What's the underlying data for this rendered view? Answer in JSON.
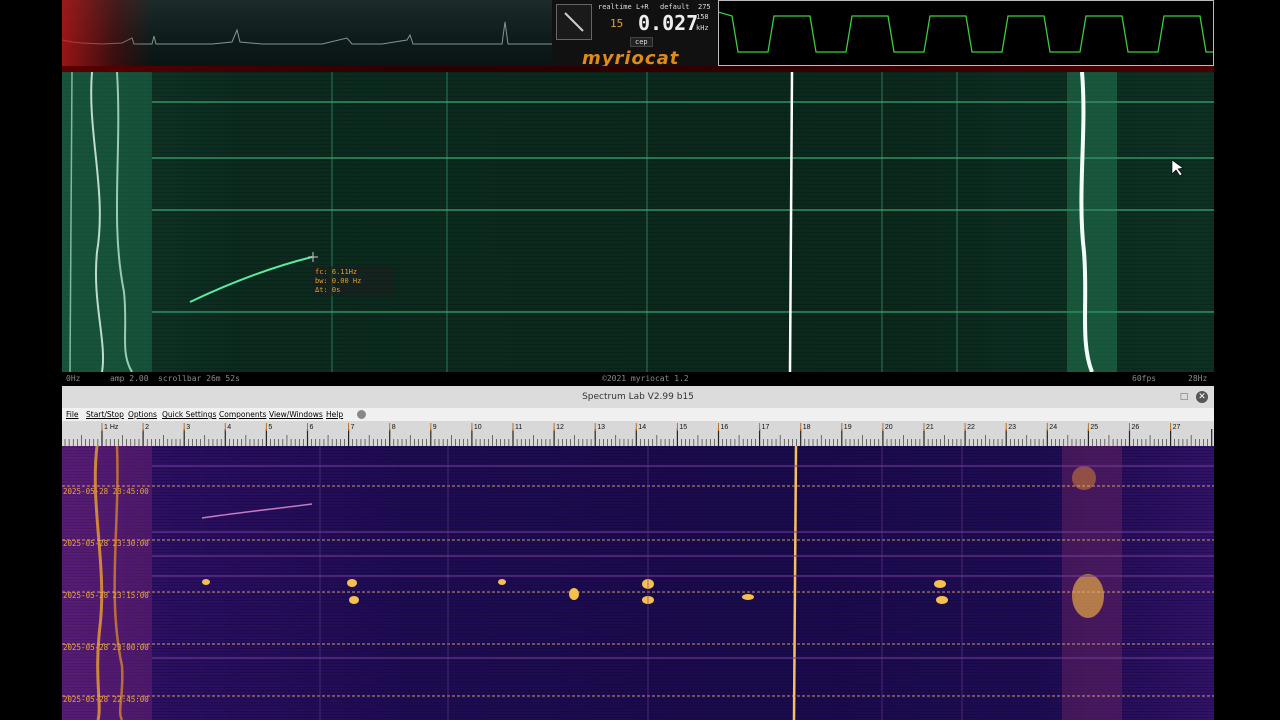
{
  "myriocat": {
    "logo": "myriocat",
    "mode": "realtime",
    "channel": "L+R",
    "preset": "default",
    "preset_value": "275",
    "gain_small": "15",
    "freq_readout": "0.027",
    "freq_top": "158",
    "freq_unit": "kHz",
    "btn_cep": "cep",
    "tooltip": {
      "fc": "fc: 6.11Hz",
      "bw": "bw: 0.00 Hz",
      "dt": "Δt: 0s"
    },
    "status": {
      "start_freq": "0Hz",
      "amp": "amp 2.00",
      "scroll": "scrollbar 26m 52s",
      "copyright": "©2021 myriocat 1.2",
      "fps": "60fps",
      "end_freq": "28Hz"
    }
  },
  "spectrum_lab": {
    "title": "Spectrum Lab V2.99 b15",
    "menu": [
      "File",
      "Start/Stop",
      "Options",
      "Quick Settings",
      "Components",
      "View/Windows",
      "Help"
    ],
    "ruler_labels": [
      "1 Hz",
      "2",
      "3",
      "4",
      "5",
      "6",
      "7",
      "8",
      "9",
      "10",
      "11",
      "12",
      "13",
      "14",
      "15",
      "16",
      "17",
      "18",
      "19",
      "20",
      "21",
      "22",
      "23",
      "24",
      "25",
      "26",
      "27"
    ],
    "timestamps": [
      "2025-05-28 23:45:00",
      "2025-05-28 23:30:00",
      "2025-05-28 23:15:00",
      "2025-05-28 23:00:00",
      "2025-05-28 22:45:00"
    ]
  }
}
